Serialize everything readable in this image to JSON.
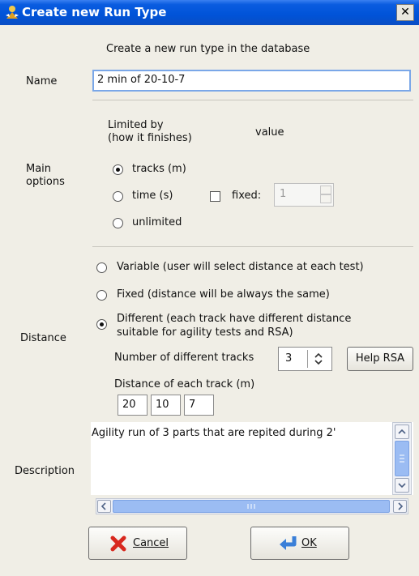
{
  "window": {
    "title": "Create new Run Type",
    "close_label": "✕"
  },
  "header": {
    "description": "Create a new run type in the database"
  },
  "name": {
    "label": "Name",
    "value": "2 min of 20-10-7"
  },
  "main_options": {
    "label": "Main\noptions",
    "limited_by_label": "Limited by\n(how it finishes)",
    "value_label": "value",
    "options": [
      {
        "label": "tracks (m)",
        "checked": true
      },
      {
        "label": "time (s)",
        "checked": false
      },
      {
        "label": "unlimited",
        "checked": false
      }
    ],
    "fixed_label": "fixed:",
    "fixed_checked": false,
    "fixed_value": "1"
  },
  "distance": {
    "label": "Distance",
    "options": [
      {
        "label": "Variable (user will select distance at each test)",
        "checked": false
      },
      {
        "label": "Fixed (distance will be always the same)",
        "checked": false
      },
      {
        "label": "Different (each track have different distance\nsuitable for agility tests and RSA)",
        "checked": true
      }
    ],
    "num_tracks_label": "Number of different tracks",
    "num_tracks_value": "3",
    "help_button": "Help RSA",
    "each_track_label": "Distance of each track  (m)",
    "tracks": [
      "20",
      "10",
      "7"
    ]
  },
  "description": {
    "label": "Description",
    "text": "Agility run of 3 parts that are repited during 2'"
  },
  "buttons": {
    "cancel": "Cancel",
    "ok": "OK"
  },
  "colors": {
    "titlebar": "#0053d8",
    "dialog_bg": "#f0eee6",
    "scroll_thumb": "#9bbcf3",
    "cancel_icon": "#d8281e",
    "ok_icon": "#3a7fd8"
  }
}
